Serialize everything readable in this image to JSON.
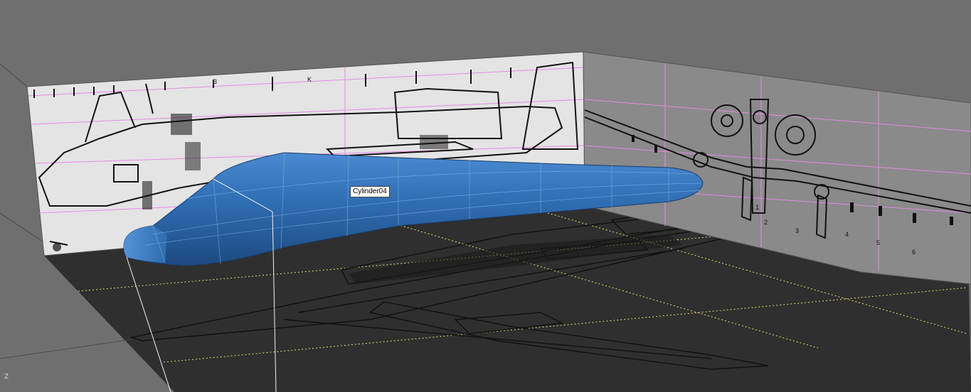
{
  "viewport": {
    "selected_object_label": "Cylinder04",
    "axis_indicator": "Z",
    "colors": {
      "background": "#6f6f6f",
      "floor_plane": "#2f2f2f",
      "side_blueprint_plane": "#e4e4e4",
      "front_blueprint_plane": "#8a8a8a",
      "selected_mesh": "#2f6db2",
      "bounding_box": "#ffffff",
      "grid_lines": "#e8e06a",
      "blueprint_gridlines": "#e48ae4"
    }
  },
  "side_blueprint": {
    "station_numbers": [
      "3",
      "K"
    ]
  },
  "front_blueprint": {
    "station_numbers": [
      "1",
      "2",
      "3",
      "4",
      "5",
      "6"
    ]
  }
}
